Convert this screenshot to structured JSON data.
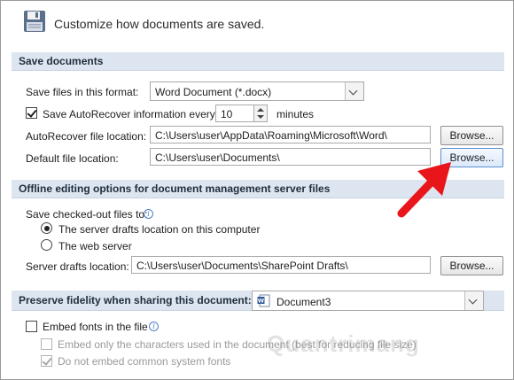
{
  "header": {
    "title": "Customize how documents are saved."
  },
  "save_documents": {
    "section_title": "Save documents",
    "format_label": "Save files in this format:",
    "format_value": "Word Document (*.docx)",
    "autorecover_label": "Save AutoRecover information every",
    "autorecover_checked": true,
    "autorecover_minutes": "10",
    "minutes_label": "minutes",
    "autorecover_location_label": "AutoRecover file location:",
    "autorecover_location_value": "C:\\Users\\user\\AppData\\Roaming\\Microsoft\\Word\\",
    "default_location_label": "Default file location:",
    "default_location_value": "C:\\Users\\user\\Documents\\",
    "browse_label": "Browse..."
  },
  "offline": {
    "section_title": "Offline editing options for document management server files",
    "checked_out_label": "Save checked-out files to:",
    "radio_drafts": "The server drafts location on this computer",
    "radio_web": "The web server",
    "selected": "drafts",
    "server_drafts_label": "Server drafts location:",
    "server_drafts_value": "C:\\Users\\user\\Documents\\SharePoint Drafts\\",
    "browse_label": "Browse..."
  },
  "fidelity": {
    "section_title": "Preserve fidelity when sharing this document:",
    "document_value": "Document3",
    "embed_fonts_label": "Embed fonts in the file",
    "embed_fonts_checked": false,
    "embed_chars_label": "Embed only the characters used in the document (best for reducing file size)",
    "embed_chars_checked": false,
    "no_common_label": "Do not embed common system fonts",
    "no_common_checked": true
  },
  "overlay": {
    "watermark": "Quantrimang",
    "arrow_color": "#e8161b"
  },
  "colors": {
    "section_bg": "#dde5f0",
    "accent": "#2b5797"
  }
}
